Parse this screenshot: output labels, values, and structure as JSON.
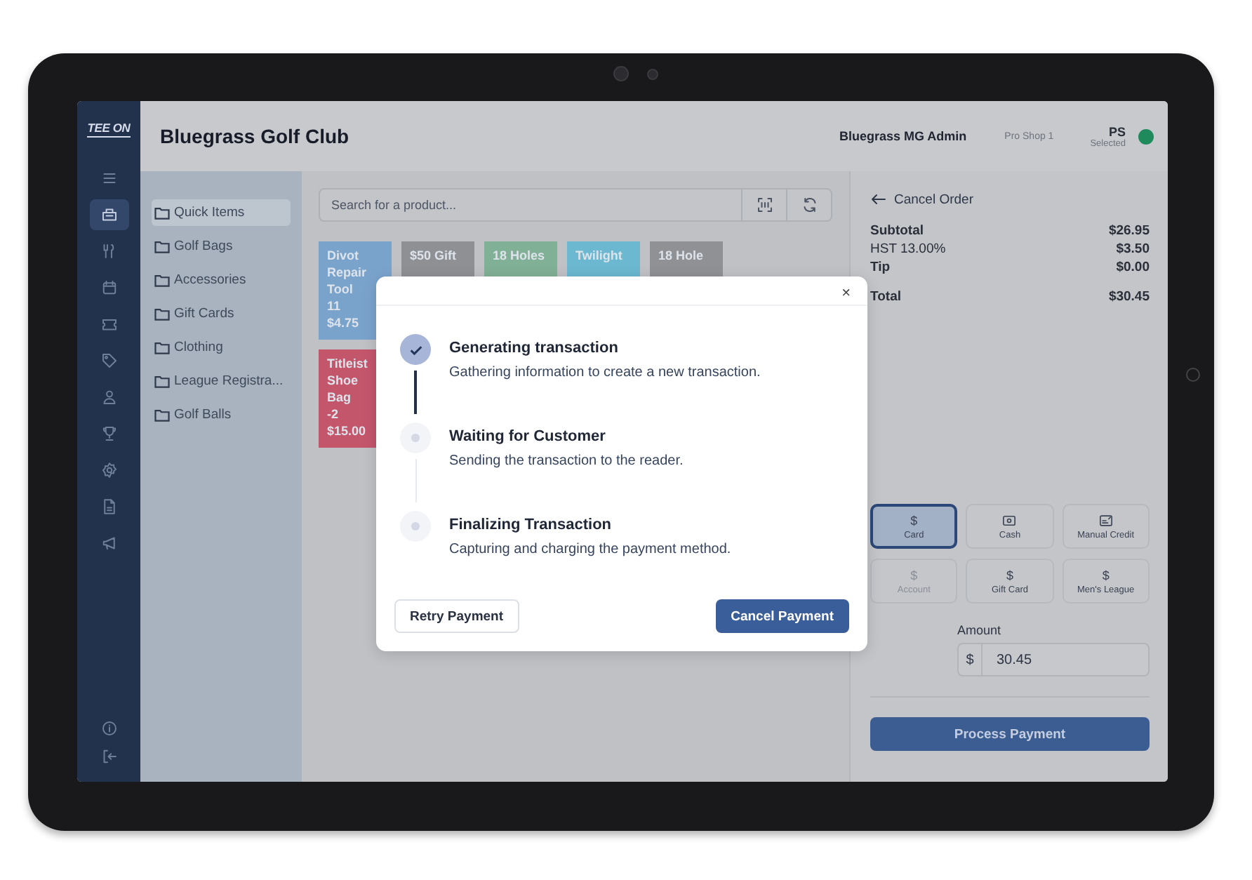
{
  "logo": "TEE ON",
  "nav_items": [
    {
      "selected": false
    },
    {
      "selected": true
    },
    {
      "selected": false
    },
    {
      "selected": false
    },
    {
      "selected": false
    },
    {
      "selected": false
    },
    {
      "selected": false
    },
    {
      "selected": false
    },
    {
      "selected": false
    },
    {
      "selected": false
    },
    {
      "selected": false
    }
  ],
  "header": {
    "title": "Bluegrass Golf Club",
    "user": "Bluegrass MG Admin",
    "location": "Pro Shop 1",
    "station": "PS",
    "station_state": "Selected"
  },
  "categories": [
    {
      "label": "Quick Items",
      "selected": true
    },
    {
      "label": "Golf Bags",
      "selected": false
    },
    {
      "label": "Accessories",
      "selected": false
    },
    {
      "label": "Gift Cards",
      "selected": false
    },
    {
      "label": "Clothing",
      "selected": false
    },
    {
      "label": "League Registra...",
      "selected": false
    },
    {
      "label": "Golf Balls",
      "selected": false
    }
  ],
  "search": {
    "placeholder": "Search for a product..."
  },
  "tiles": [
    {
      "lines": [
        "Divot Repair Tool",
        "11",
        "$4.75"
      ],
      "color": "#7aa3cc"
    },
    {
      "lines": [
        "$50 Gift"
      ],
      "color": "#8e9094"
    },
    {
      "lines": [
        "18 Holes"
      ],
      "color": "#80b096"
    },
    {
      "lines": [
        "Twilight"
      ],
      "color": "#6cb8d0"
    },
    {
      "lines": [
        "18 Hole"
      ],
      "color": "#8f9195"
    },
    {
      "lines": [
        "Titleist Shoe Bag",
        "-2",
        "$15.00"
      ],
      "color": "#c4566c"
    }
  ],
  "order": {
    "back": "Cancel Order",
    "summary": [
      {
        "label": "Subtotal",
        "value": "$26.95"
      },
      {
        "label": "HST 13.00%",
        "value": "$3.50"
      },
      {
        "label": "Tip",
        "value": "$0.00"
      }
    ],
    "total": {
      "label": "Total",
      "value": "$30.45"
    },
    "payment_methods": [
      {
        "label": "Card",
        "icon_text": "$",
        "selected": true,
        "disabled": false
      },
      {
        "label": "Cash",
        "selected": false,
        "disabled": false
      },
      {
        "label": "Manual Credit",
        "selected": false,
        "disabled": false
      },
      {
        "label": "Account",
        "icon_text": "$",
        "selected": false,
        "disabled": true
      },
      {
        "label": "Gift Card",
        "icon_text": "$",
        "selected": false,
        "disabled": false
      },
      {
        "label": "Men's League",
        "icon_text": "$",
        "selected": false,
        "disabled": false
      }
    ],
    "amount": {
      "label": "Amount",
      "prefix": "$",
      "value": "30.45"
    },
    "submit": "Process Payment"
  },
  "dialog": {
    "close": "×",
    "steps": [
      {
        "title": "Generating transaction",
        "description": "Gathering information to create a new transaction.",
        "done": true
      },
      {
        "title": "Waiting for Customer",
        "description": "Sending the transaction to the reader.",
        "done": false
      },
      {
        "title": "Finalizing Transaction",
        "description": "Capturing and charging the payment method.",
        "done": false
      }
    ],
    "secondary": "Retry Payment",
    "primary": "Cancel Payment"
  }
}
